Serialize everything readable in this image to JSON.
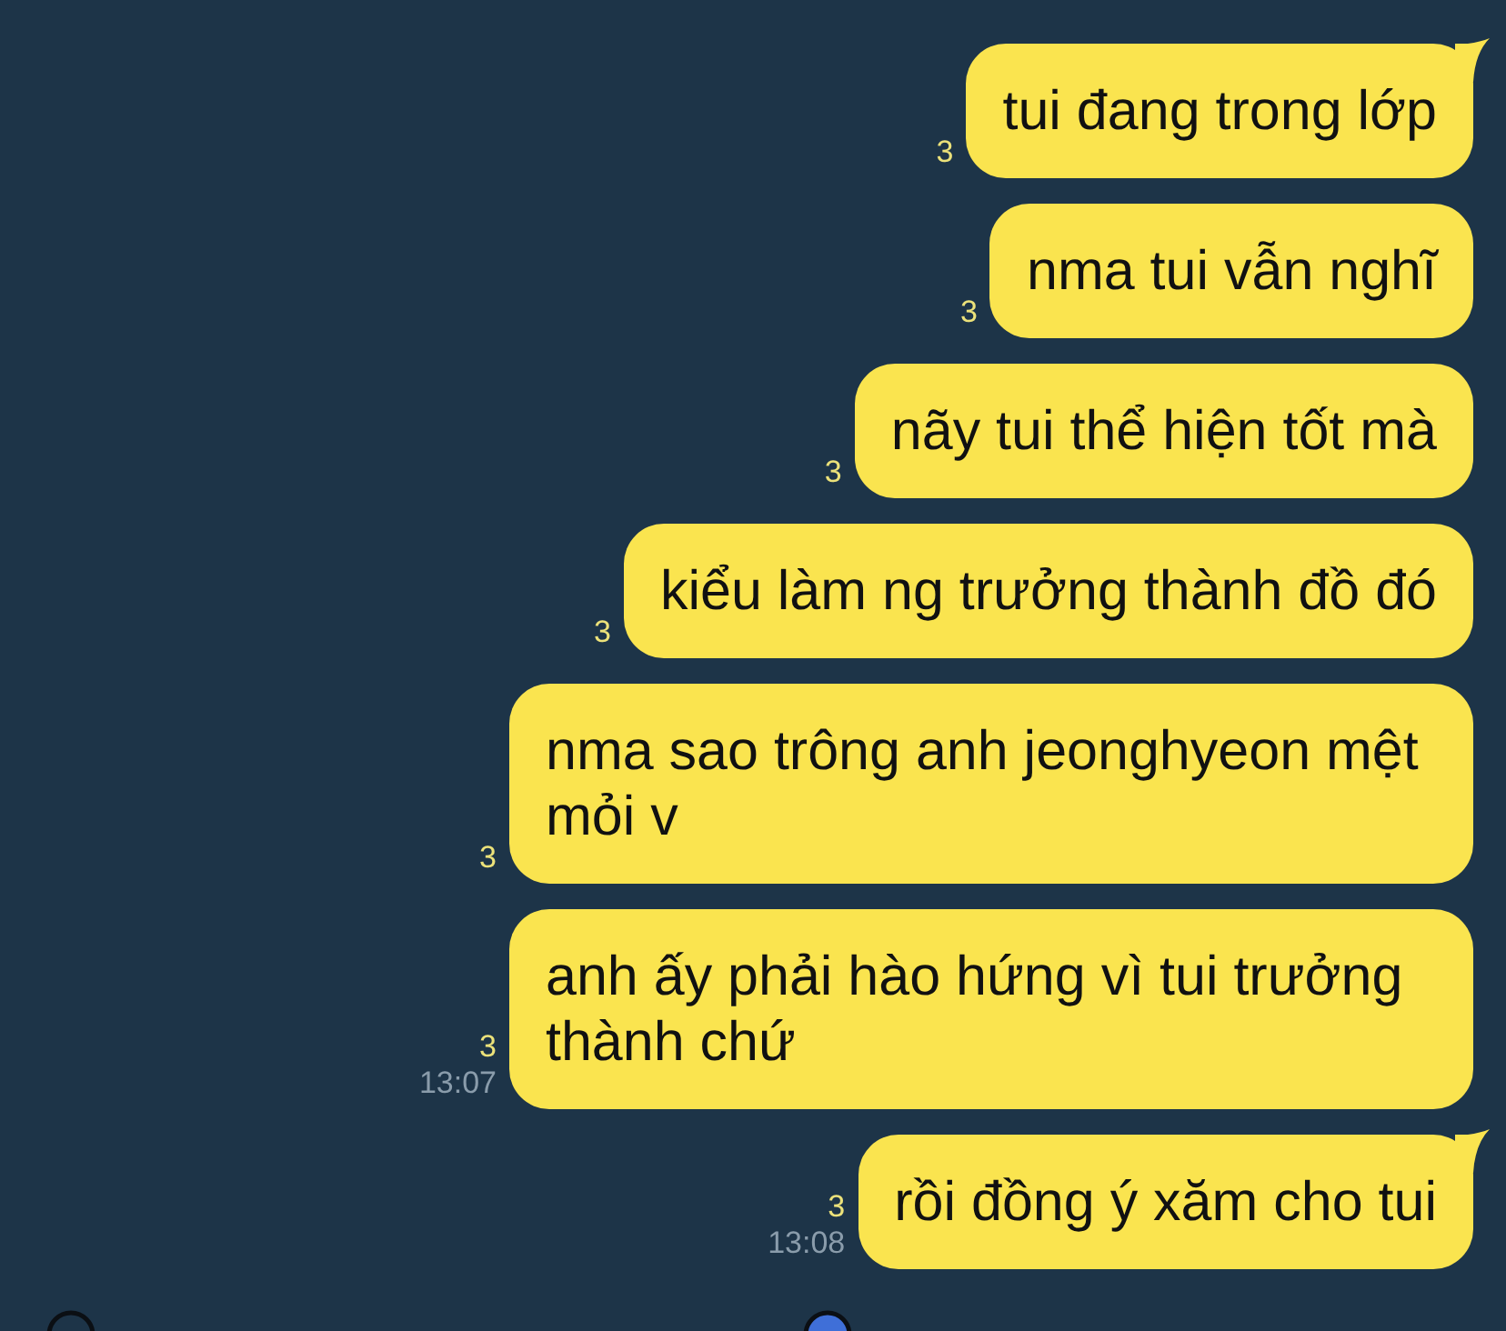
{
  "messages": [
    {
      "text": "tui đang trong lớp",
      "read_count": "3",
      "tail": true
    },
    {
      "text": "nma tui vẫn nghĩ",
      "read_count": "3",
      "tail": false
    },
    {
      "text": "nãy tui thể hiện tốt mà",
      "read_count": "3",
      "tail": false
    },
    {
      "text": "kiểu làm ng trưởng thành đồ đó",
      "read_count": "3",
      "tail": false
    },
    {
      "text": "nma sao trông anh jeonghyeon mệt mỏi v",
      "read_count": "3",
      "tail": false
    },
    {
      "text": "anh ấy phải hào hứng vì tui trưởng thành chứ",
      "read_count": "3",
      "time": "13:07",
      "tail": false
    },
    {
      "text": "rồi đồng ý xăm cho tui",
      "read_count": "3",
      "time": "13:08",
      "tail": true
    }
  ],
  "bottom_bar": {
    "items": [
      {
        "kind": "ring"
      },
      {
        "kind": "dot"
      }
    ]
  }
}
